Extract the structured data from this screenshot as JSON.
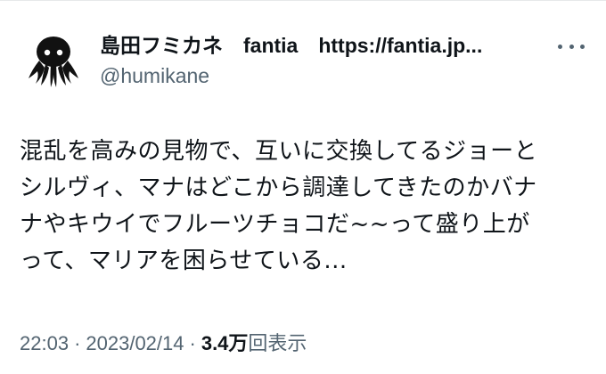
{
  "tweet": {
    "author": {
      "display_name": "島田フミカネ　fantia　https://fantia.jp...",
      "handle": "@humikane",
      "avatar_icon": "octopus-avatar-icon"
    },
    "more_icon": "more-options-icon",
    "text_lines": [
      "混乱を高みの見物で、互いに交換してるジョーと",
      "シルヴィ、マナはどこから調達してきたのかバナ",
      "ナやキウイでフルーツチョコだ~~って盛り上が",
      "って、マリアを困らせている..."
    ],
    "meta": {
      "time": "22:03",
      "separator": "·",
      "date": "2023/02/14",
      "views_count": "3.4万",
      "views_label": "回表示"
    }
  },
  "colors": {
    "text_primary": "#0f1419",
    "text_secondary": "#536471",
    "background": "#ffffff"
  }
}
